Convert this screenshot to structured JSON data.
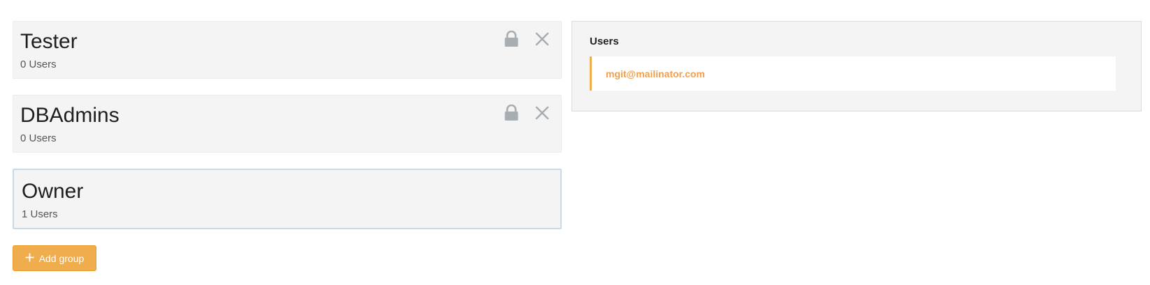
{
  "groups": [
    {
      "name": "Tester",
      "count": "0 Users",
      "locked": true,
      "removable": true
    },
    {
      "name": "DBAdmins",
      "count": "0 Users",
      "locked": true,
      "removable": true
    },
    {
      "name": "Owner",
      "count": "1 Users",
      "locked": false,
      "removable": false,
      "selected": true
    }
  ],
  "add_group": {
    "label": "Add group",
    "icon": "plus-icon"
  },
  "users_panel": {
    "title": "Users",
    "users": [
      {
        "email": "mgit@mailinator.com"
      }
    ]
  },
  "colors": {
    "accent": "#f0ad4e",
    "card_bg": "#f4f4f4",
    "icon_gray": "#a8adb2",
    "selected_border": "#c8daea",
    "email": "#f0a050"
  },
  "icons": {
    "lock": "lock-icon",
    "close": "close-icon"
  }
}
